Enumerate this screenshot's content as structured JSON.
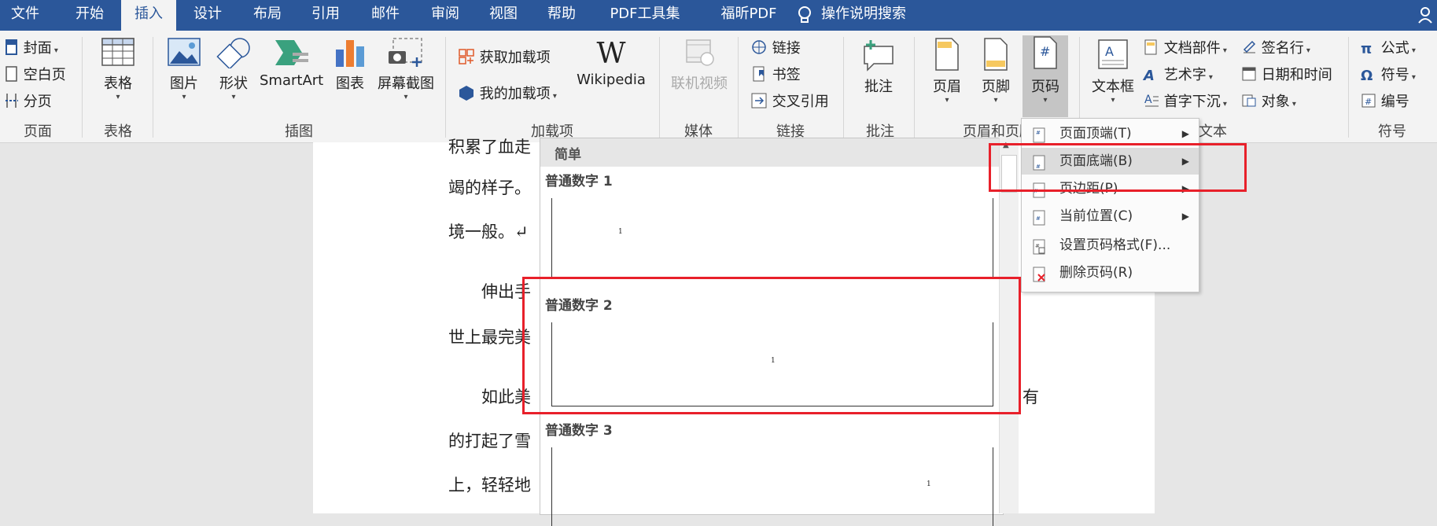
{
  "menubar": {
    "tabs": [
      "文件",
      "开始",
      "插入",
      "设计",
      "布局",
      "引用",
      "邮件",
      "审阅",
      "视图",
      "帮助",
      "PDF工具集",
      "福昕PDF"
    ],
    "active_tab": "插入",
    "tell_me": "操作说明搜索"
  },
  "ribbon": {
    "pages": {
      "cover": "封面",
      "blank": "空白页",
      "break": "分页",
      "group": "页面"
    },
    "tables": {
      "table": "表格",
      "group": "表格"
    },
    "illustrations": {
      "picture": "图片",
      "shapes": "形状",
      "smartart": "SmartArt",
      "chart": "图表",
      "screenshot": "屏幕截图",
      "group": "插图"
    },
    "addins": {
      "get": "获取加载项",
      "mine": "我的加载项",
      "wikipedia": "Wikipedia",
      "group": "加载项"
    },
    "media": {
      "video": "联机视频",
      "group": "媒体"
    },
    "links": {
      "link": "链接",
      "bookmark": "书签",
      "crossref": "交叉引用",
      "group": "链接"
    },
    "comments": {
      "comment": "批注",
      "group": "批注"
    },
    "header_footer": {
      "header": "页眉",
      "footer": "页脚",
      "page_number": "页码",
      "group": "页眉和页脚"
    },
    "text": {
      "textbox": "文本框",
      "quickparts": "文档部件",
      "wordart": "艺术字",
      "dropcap": "首字下沉",
      "signature": "签名行",
      "datetime": "日期和时间",
      "object": "对象",
      "group": "文本"
    },
    "symbols": {
      "equation": "公式",
      "symbol": "符号",
      "number": "编号",
      "group": "符号"
    }
  },
  "document": {
    "lines": [
      "积累了血走",
      "竭的样子。",
      "境一般。↵",
      "伸出手",
      "世上最完美",
      "如此美",
      "的打起了雪",
      "上，轻轻地"
    ],
    "right_fragments": [
      "有"
    ]
  },
  "gallery": {
    "section": "简单",
    "items": [
      {
        "label": "普通数字 1",
        "num": "1",
        "align": "left"
      },
      {
        "label": "普通数字 2",
        "num": "1",
        "align": "center"
      },
      {
        "label": "普通数字 3",
        "num": "1",
        "align": "right"
      }
    ]
  },
  "submenu": {
    "items": [
      {
        "label": "页面顶端(T)",
        "arrow": true
      },
      {
        "label": "页面底端(B)",
        "arrow": true
      },
      {
        "label": "页边距(P)",
        "arrow": true
      },
      {
        "label": "当前位置(C)",
        "arrow": true
      },
      {
        "label": "设置页码格式(F)...",
        "arrow": false
      },
      {
        "label": "删除页码(R)",
        "arrow": false
      }
    ]
  },
  "colors": {
    "accent": "#2b579a",
    "highlight": "#e8202a"
  }
}
